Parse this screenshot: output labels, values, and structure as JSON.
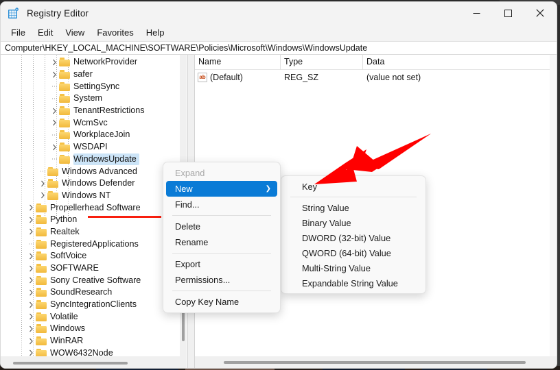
{
  "window": {
    "title": "Registry Editor",
    "icon": "registry-editor-icon",
    "controls": {
      "minimize": "—",
      "maximize": "□",
      "close": "✕"
    }
  },
  "menubar": {
    "items": [
      {
        "label": "File"
      },
      {
        "label": "Edit"
      },
      {
        "label": "View"
      },
      {
        "label": "Favorites"
      },
      {
        "label": "Help"
      }
    ]
  },
  "address": {
    "path": "Computer\\HKEY_LOCAL_MACHINE\\SOFTWARE\\Policies\\Microsoft\\Windows\\WindowsUpdate"
  },
  "tree": {
    "items": [
      {
        "label": "NetworkProvider",
        "depth": 3,
        "expandable": true,
        "selected": false
      },
      {
        "label": "safer",
        "depth": 3,
        "expandable": true,
        "selected": false
      },
      {
        "label": "SettingSync",
        "depth": 3,
        "expandable": false,
        "selected": false
      },
      {
        "label": "System",
        "depth": 3,
        "expandable": false,
        "selected": false
      },
      {
        "label": "TenantRestrictions",
        "depth": 3,
        "expandable": true,
        "selected": false
      },
      {
        "label": "WcmSvc",
        "depth": 3,
        "expandable": true,
        "selected": false
      },
      {
        "label": "WorkplaceJoin",
        "depth": 3,
        "expandable": false,
        "selected": false
      },
      {
        "label": "WSDAPI",
        "depth": 3,
        "expandable": true,
        "selected": false
      },
      {
        "label": "WindowsUpdate",
        "depth": 3,
        "expandable": false,
        "selected": true
      },
      {
        "label": "Windows Advanced",
        "depth": 2,
        "expandable": false,
        "selected": false
      },
      {
        "label": "Windows Defender",
        "depth": 2,
        "expandable": true,
        "selected": false
      },
      {
        "label": "Windows NT",
        "depth": 2,
        "expandable": true,
        "selected": false
      },
      {
        "label": "Propellerhead Software",
        "depth": 1,
        "expandable": true,
        "selected": false
      },
      {
        "label": "Python",
        "depth": 1,
        "expandable": true,
        "selected": false
      },
      {
        "label": "Realtek",
        "depth": 1,
        "expandable": true,
        "selected": false
      },
      {
        "label": "RegisteredApplications",
        "depth": 1,
        "expandable": false,
        "selected": false
      },
      {
        "label": "SoftVoice",
        "depth": 1,
        "expandable": true,
        "selected": false
      },
      {
        "label": "SOFTWARE",
        "depth": 1,
        "expandable": true,
        "selected": false
      },
      {
        "label": "Sony Creative Software",
        "depth": 1,
        "expandable": true,
        "selected": false
      },
      {
        "label": "SoundResearch",
        "depth": 1,
        "expandable": true,
        "selected": false
      },
      {
        "label": "SyncIntegrationClients",
        "depth": 1,
        "expandable": true,
        "selected": false
      },
      {
        "label": "Volatile",
        "depth": 1,
        "expandable": true,
        "selected": false
      },
      {
        "label": "Windows",
        "depth": 1,
        "expandable": true,
        "selected": false
      },
      {
        "label": "WinRAR",
        "depth": 1,
        "expandable": true,
        "selected": false
      },
      {
        "label": "WOW6432Node",
        "depth": 1,
        "expandable": true,
        "selected": false
      }
    ]
  },
  "list": {
    "columns": [
      {
        "label": "Name"
      },
      {
        "label": "Type"
      },
      {
        "label": "Data"
      }
    ],
    "rows": [
      {
        "icon": "string-value-icon",
        "name": "(Default)",
        "type": "REG_SZ",
        "data": "(value not set)"
      }
    ]
  },
  "context_menu": {
    "items": [
      {
        "label": "Expand",
        "state": "disabled",
        "submenu": false
      },
      {
        "label": "New",
        "state": "active",
        "submenu": true
      },
      {
        "label": "Find...",
        "state": "normal",
        "submenu": false
      },
      {
        "separator": true
      },
      {
        "label": "Delete",
        "state": "normal",
        "submenu": false
      },
      {
        "label": "Rename",
        "state": "normal",
        "submenu": false
      },
      {
        "separator": true
      },
      {
        "label": "Export",
        "state": "normal",
        "submenu": false
      },
      {
        "label": "Permissions...",
        "state": "normal",
        "submenu": false
      },
      {
        "separator": true
      },
      {
        "label": "Copy Key Name",
        "state": "normal",
        "submenu": false
      }
    ],
    "submenu_arrow": "❯"
  },
  "submenu": {
    "items": [
      {
        "label": "Key"
      },
      {
        "separator": true
      },
      {
        "label": "String Value"
      },
      {
        "label": "Binary Value"
      },
      {
        "label": "DWORD (32-bit) Value"
      },
      {
        "label": "QWORD (64-bit) Value"
      },
      {
        "label": "Multi-String Value"
      },
      {
        "label": "Expandable String Value"
      }
    ]
  },
  "annotations": {
    "arrow": {
      "name": "red-arrow-annotation",
      "color": "#FF0000",
      "points_to": "Key"
    },
    "underline": {
      "name": "red-underline-annotation",
      "color": "#F81F0F",
      "under": "WindowsUpdate"
    }
  },
  "colors": {
    "accent": "#0A7BD6",
    "selection": "#CCE4F7",
    "folder": "#F2B93C",
    "annotation": "#FF0000",
    "window_bg": "#F3F3F3"
  }
}
